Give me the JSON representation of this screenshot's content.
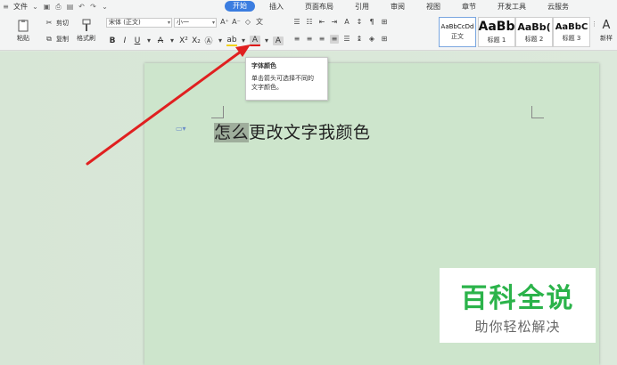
{
  "menubar": {
    "file_label": "文件",
    "tabs": [
      {
        "label": "开始",
        "active": true
      },
      {
        "label": "插入"
      },
      {
        "label": "页面布局"
      },
      {
        "label": "引用"
      },
      {
        "label": "审阅"
      },
      {
        "label": "视图"
      },
      {
        "label": "章节"
      },
      {
        "label": "开发工具"
      },
      {
        "label": "云服务"
      }
    ]
  },
  "ribbon": {
    "paste_label": "粘贴",
    "cut_label": "剪切",
    "copy_label": "复制",
    "format_painter_label": "格式刷",
    "font_name": "宋体 (正文)",
    "font_size": "小一",
    "styles": [
      {
        "preview": "AaBbCcDd",
        "label": "正文"
      },
      {
        "preview": "AaBb",
        "label": "标题 1"
      },
      {
        "preview": "AaBb(",
        "label": "标题 2"
      },
      {
        "preview": "AaBbC",
        "label": "标题 3"
      }
    ],
    "new_style_label": "新样"
  },
  "tooltip": {
    "title": "字体颜色",
    "line1": "单击箭头可选择不同的",
    "line2": "文字颜色。"
  },
  "document": {
    "selected_text": "怎么",
    "rest_text": "更改文字我颜色"
  },
  "watermark": {
    "main": "百科全说",
    "sub": "助你轻松解决"
  },
  "colors": {
    "accent": "#3b7de0",
    "page_bg": "#cde5cc",
    "arrow": "#e02020",
    "watermark_green": "#2bb34a"
  }
}
